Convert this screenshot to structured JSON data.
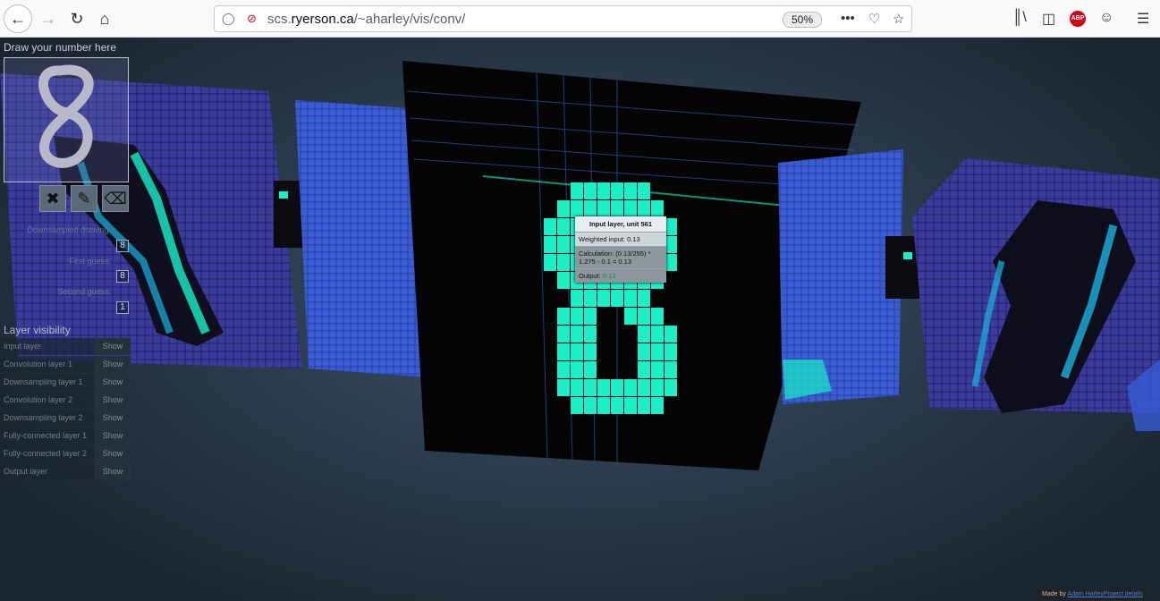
{
  "browser": {
    "url_prefix": "scs.",
    "url_domain": "ryerson.ca",
    "url_path": "/~aharley/vis/conv/",
    "zoom": "50%",
    "abp_label": "ABP"
  },
  "app": {
    "draw_label": "Draw your number here",
    "downsampled_label": "Downsampled drawing:",
    "downsampled_value": "8",
    "first_guess_label": "First guess:",
    "first_guess_value": "8",
    "second_guess_label": "Second guess:",
    "second_guess_value": "1",
    "layer_visibility_title": "Layer visibility",
    "layers": [
      {
        "name": "Input layer",
        "action": "Show"
      },
      {
        "name": "Convolution layer 1",
        "action": "Show"
      },
      {
        "name": "Downsampling layer 1",
        "action": "Show"
      },
      {
        "name": "Convolution layer 2",
        "action": "Show"
      },
      {
        "name": "Downsampling layer 2",
        "action": "Show"
      },
      {
        "name": "Fully-connected layer 1",
        "action": "Show"
      },
      {
        "name": "Fully-connected layer 2",
        "action": "Show"
      },
      {
        "name": "Output layer",
        "action": "Show"
      }
    ]
  },
  "tooltip": {
    "title": "Input layer, unit 561",
    "weighted_input": "Weighted input: 0.13",
    "calculation": "Calculation: (0.13/255) * 1.275 - 0.1 = 0.13",
    "output_label": "Output:",
    "output_value": "0.13"
  },
  "footer": {
    "made_by": "Made by",
    "author": "Adam Harley",
    "details": "Project details"
  },
  "colors": {
    "cyan": "#19f0c8",
    "blue_panel": "#3a5cd6",
    "indigo_panel": "#3b3a9c"
  }
}
